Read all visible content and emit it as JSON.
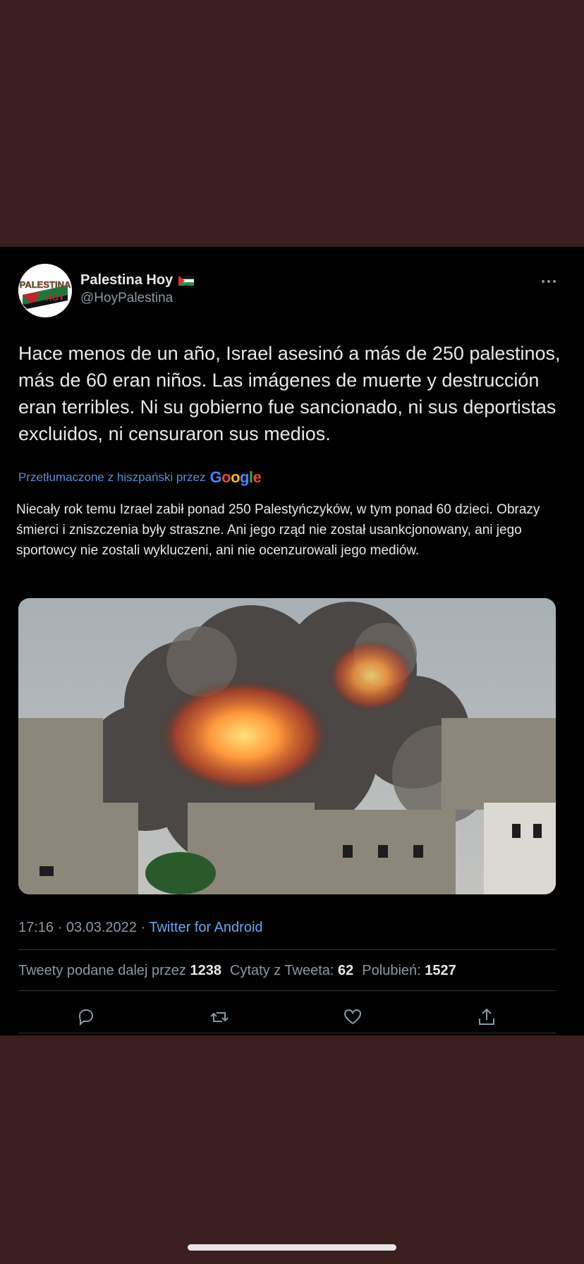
{
  "author": {
    "display_name": "Palestina Hoy",
    "handle": "@HoyPalestina",
    "avatar_text_top": "PALESTINA",
    "avatar_text_bottom": "HOY",
    "flag_icon": "palestine-flag-icon"
  },
  "tweet": {
    "text": "Hace menos de un año, Israel asesinó a más de 250 palestinos, más de 60 eran niños. Las imágenes de muerte y destrucción eran terribles. Ni su gobierno fue sancionado, ni sus deportistas excluidos, ni censuraron sus medios.",
    "translated_label": "Przetłumaczone z hiszpański przez",
    "translated_provider": "Google",
    "translation": "Niecały rok temu Izrael zabił ponad 250 Palestyńczyków, w tym ponad 60 dzieci. Obrazy śmierci i zniszczenia były straszne. Ani jego rząd nie został usankcjonowany, ani jego sportowcy nie zostali wykluczeni, ani nie ocenzurowali jego mediów.",
    "time": "17:16 · 03.03.2022 · ",
    "source": "Twitter for Android"
  },
  "stats": {
    "retweets_label": "Tweety podane dalej przez",
    "retweets": "1238",
    "quotes_label": "Cytaty z Tweeta:",
    "quotes": "62",
    "likes_label": "Polubień:",
    "likes": "1527"
  },
  "icons": [
    "more-icon",
    "reply-icon",
    "retweet-icon",
    "like-icon",
    "share-icon"
  ],
  "colors": {
    "background": "#3b1f1f",
    "card": "#000000",
    "text": "#e7e9ea",
    "muted": "#8b98a5",
    "link": "#6aa6f0"
  }
}
